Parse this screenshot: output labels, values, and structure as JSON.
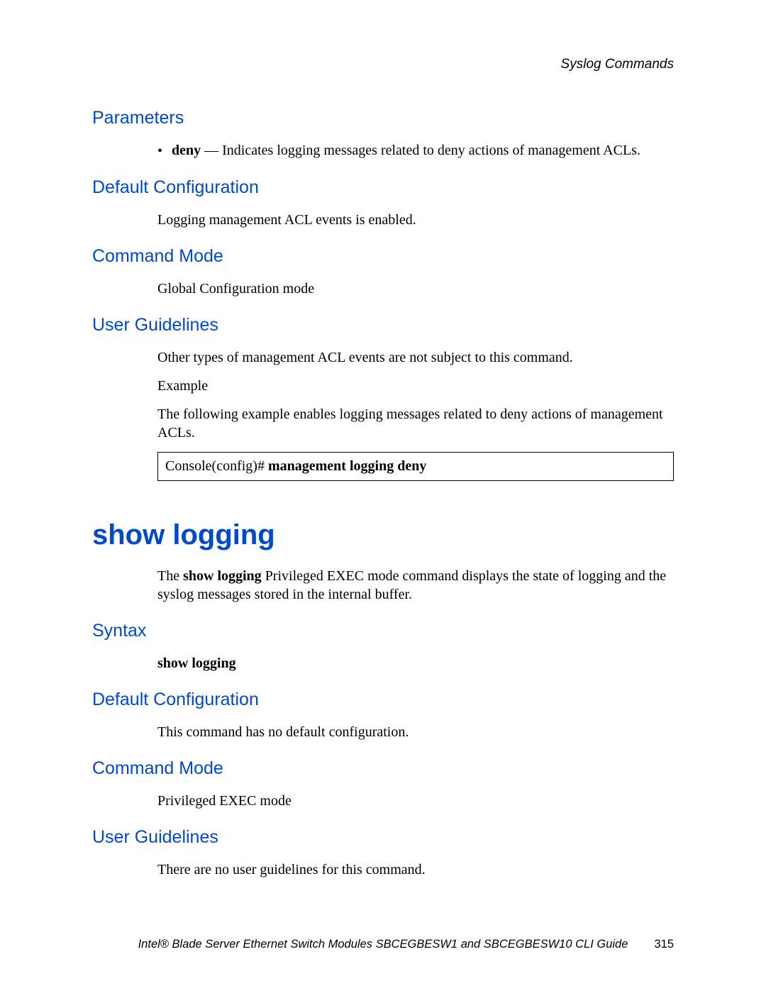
{
  "header": {
    "section": "Syslog Commands"
  },
  "sections": {
    "parameters": {
      "heading": "Parameters",
      "bullet_label": "deny",
      "bullet_sep": " — ",
      "bullet_text": "Indicates logging messages related to deny actions of management ACLs."
    },
    "default_config_1": {
      "heading": "Default Configuration",
      "body": "Logging management ACL events is enabled."
    },
    "command_mode_1": {
      "heading": "Command Mode",
      "body": "Global Configuration mode"
    },
    "user_guidelines_1": {
      "heading": "User Guidelines",
      "body1": "Other types of management ACL events are not subject to this command.",
      "body2": "Example",
      "body3": "The following example enables logging messages related to deny actions of management ACLs.",
      "code_prefix": "Console(config)# ",
      "code_bold": "management logging deny"
    },
    "show_logging": {
      "heading": "show logging",
      "intro_prefix": "The ",
      "intro_bold": "show logging",
      "intro_suffix": " Privileged EXEC mode command displays the state of logging and the syslog messages stored in the internal buffer."
    },
    "syntax": {
      "heading": "Syntax",
      "body_bold": "show logging"
    },
    "default_config_2": {
      "heading": "Default Configuration",
      "body": "This command has no default configuration."
    },
    "command_mode_2": {
      "heading": "Command Mode",
      "body": "Privileged EXEC mode"
    },
    "user_guidelines_2": {
      "heading": "User Guidelines",
      "body": "There are no user guidelines for this command."
    }
  },
  "footer": {
    "title": "Intel® Blade Server Ethernet Switch Modules SBCEGBESW1 and SBCEGBESW10 CLI Guide",
    "page": "315"
  }
}
